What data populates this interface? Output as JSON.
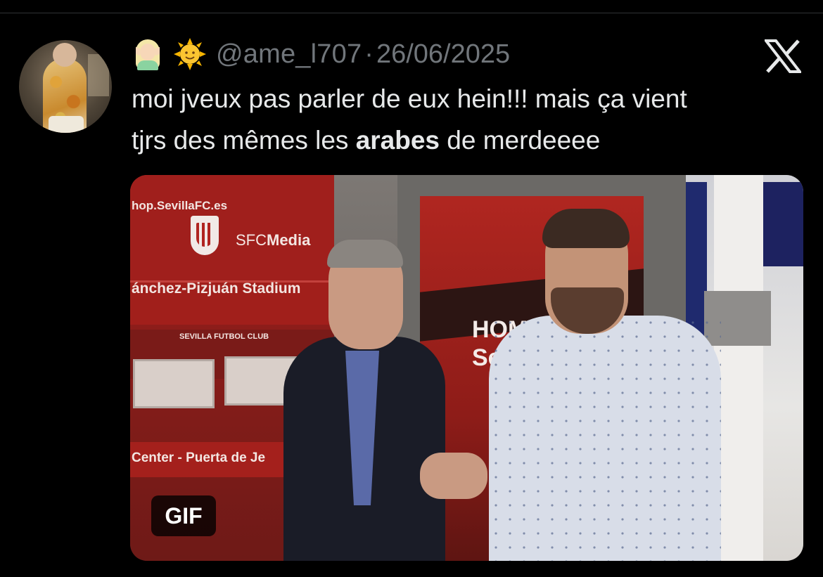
{
  "tweet": {
    "author": {
      "display_emojis": [
        "elf-emoji",
        "sun-emoji"
      ],
      "handle": "@ame_l707",
      "separator": "·",
      "date": "26/06/2025"
    },
    "text": {
      "line1": "moi jveux pas parler de eux hein!!! mais ça vient",
      "line2_before": "tjrs des mêmes les ",
      "line2_bold": "arabes",
      "line2_after": " de merdeeee"
    },
    "media": {
      "badge": "GIF",
      "sign_shop": "hop.SevillaFC.es",
      "sign_media_prefix": "SFC",
      "sign_media_bold": "Media",
      "sign_stadium": "ánchez-Pizjuán Stadium",
      "sign_club": "SEVILLA FUTBOL CLUB",
      "sign_center": "Center - Puerta de Je",
      "sign_home_1": "HOM",
      "sign_home_2": "Se"
    },
    "platform_icon": "x-logo-icon"
  },
  "colors": {
    "background": "#000000",
    "text_primary": "#e7e9ea",
    "text_secondary": "#71767b"
  }
}
